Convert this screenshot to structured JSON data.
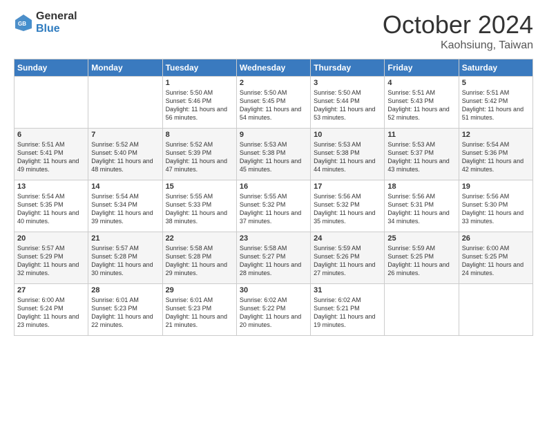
{
  "logo": {
    "general": "General",
    "blue": "Blue"
  },
  "header": {
    "month": "October 2024",
    "location": "Kaohsiung, Taiwan"
  },
  "weekdays": [
    "Sunday",
    "Monday",
    "Tuesday",
    "Wednesday",
    "Thursday",
    "Friday",
    "Saturday"
  ],
  "weeks": [
    [
      {
        "day": "",
        "sunrise": "",
        "sunset": "",
        "daylight": ""
      },
      {
        "day": "",
        "sunrise": "",
        "sunset": "",
        "daylight": ""
      },
      {
        "day": "1",
        "sunrise": "Sunrise: 5:50 AM",
        "sunset": "Sunset: 5:46 PM",
        "daylight": "Daylight: 11 hours and 56 minutes."
      },
      {
        "day": "2",
        "sunrise": "Sunrise: 5:50 AM",
        "sunset": "Sunset: 5:45 PM",
        "daylight": "Daylight: 11 hours and 54 minutes."
      },
      {
        "day": "3",
        "sunrise": "Sunrise: 5:50 AM",
        "sunset": "Sunset: 5:44 PM",
        "daylight": "Daylight: 11 hours and 53 minutes."
      },
      {
        "day": "4",
        "sunrise": "Sunrise: 5:51 AM",
        "sunset": "Sunset: 5:43 PM",
        "daylight": "Daylight: 11 hours and 52 minutes."
      },
      {
        "day": "5",
        "sunrise": "Sunrise: 5:51 AM",
        "sunset": "Sunset: 5:42 PM",
        "daylight": "Daylight: 11 hours and 51 minutes."
      }
    ],
    [
      {
        "day": "6",
        "sunrise": "Sunrise: 5:51 AM",
        "sunset": "Sunset: 5:41 PM",
        "daylight": "Daylight: 11 hours and 49 minutes."
      },
      {
        "day": "7",
        "sunrise": "Sunrise: 5:52 AM",
        "sunset": "Sunset: 5:40 PM",
        "daylight": "Daylight: 11 hours and 48 minutes."
      },
      {
        "day": "8",
        "sunrise": "Sunrise: 5:52 AM",
        "sunset": "Sunset: 5:39 PM",
        "daylight": "Daylight: 11 hours and 47 minutes."
      },
      {
        "day": "9",
        "sunrise": "Sunrise: 5:53 AM",
        "sunset": "Sunset: 5:38 PM",
        "daylight": "Daylight: 11 hours and 45 minutes."
      },
      {
        "day": "10",
        "sunrise": "Sunrise: 5:53 AM",
        "sunset": "Sunset: 5:38 PM",
        "daylight": "Daylight: 11 hours and 44 minutes."
      },
      {
        "day": "11",
        "sunrise": "Sunrise: 5:53 AM",
        "sunset": "Sunset: 5:37 PM",
        "daylight": "Daylight: 11 hours and 43 minutes."
      },
      {
        "day": "12",
        "sunrise": "Sunrise: 5:54 AM",
        "sunset": "Sunset: 5:36 PM",
        "daylight": "Daylight: 11 hours and 42 minutes."
      }
    ],
    [
      {
        "day": "13",
        "sunrise": "Sunrise: 5:54 AM",
        "sunset": "Sunset: 5:35 PM",
        "daylight": "Daylight: 11 hours and 40 minutes."
      },
      {
        "day": "14",
        "sunrise": "Sunrise: 5:54 AM",
        "sunset": "Sunset: 5:34 PM",
        "daylight": "Daylight: 11 hours and 39 minutes."
      },
      {
        "day": "15",
        "sunrise": "Sunrise: 5:55 AM",
        "sunset": "Sunset: 5:33 PM",
        "daylight": "Daylight: 11 hours and 38 minutes."
      },
      {
        "day": "16",
        "sunrise": "Sunrise: 5:55 AM",
        "sunset": "Sunset: 5:32 PM",
        "daylight": "Daylight: 11 hours and 37 minutes."
      },
      {
        "day": "17",
        "sunrise": "Sunrise: 5:56 AM",
        "sunset": "Sunset: 5:32 PM",
        "daylight": "Daylight: 11 hours and 35 minutes."
      },
      {
        "day": "18",
        "sunrise": "Sunrise: 5:56 AM",
        "sunset": "Sunset: 5:31 PM",
        "daylight": "Daylight: 11 hours and 34 minutes."
      },
      {
        "day": "19",
        "sunrise": "Sunrise: 5:56 AM",
        "sunset": "Sunset: 5:30 PM",
        "daylight": "Daylight: 11 hours and 33 minutes."
      }
    ],
    [
      {
        "day": "20",
        "sunrise": "Sunrise: 5:57 AM",
        "sunset": "Sunset: 5:29 PM",
        "daylight": "Daylight: 11 hours and 32 minutes."
      },
      {
        "day": "21",
        "sunrise": "Sunrise: 5:57 AM",
        "sunset": "Sunset: 5:28 PM",
        "daylight": "Daylight: 11 hours and 30 minutes."
      },
      {
        "day": "22",
        "sunrise": "Sunrise: 5:58 AM",
        "sunset": "Sunset: 5:28 PM",
        "daylight": "Daylight: 11 hours and 29 minutes."
      },
      {
        "day": "23",
        "sunrise": "Sunrise: 5:58 AM",
        "sunset": "Sunset: 5:27 PM",
        "daylight": "Daylight: 11 hours and 28 minutes."
      },
      {
        "day": "24",
        "sunrise": "Sunrise: 5:59 AM",
        "sunset": "Sunset: 5:26 PM",
        "daylight": "Daylight: 11 hours and 27 minutes."
      },
      {
        "day": "25",
        "sunrise": "Sunrise: 5:59 AM",
        "sunset": "Sunset: 5:25 PM",
        "daylight": "Daylight: 11 hours and 26 minutes."
      },
      {
        "day": "26",
        "sunrise": "Sunrise: 6:00 AM",
        "sunset": "Sunset: 5:25 PM",
        "daylight": "Daylight: 11 hours and 24 minutes."
      }
    ],
    [
      {
        "day": "27",
        "sunrise": "Sunrise: 6:00 AM",
        "sunset": "Sunset: 5:24 PM",
        "daylight": "Daylight: 11 hours and 23 minutes."
      },
      {
        "day": "28",
        "sunrise": "Sunrise: 6:01 AM",
        "sunset": "Sunset: 5:23 PM",
        "daylight": "Daylight: 11 hours and 22 minutes."
      },
      {
        "day": "29",
        "sunrise": "Sunrise: 6:01 AM",
        "sunset": "Sunset: 5:23 PM",
        "daylight": "Daylight: 11 hours and 21 minutes."
      },
      {
        "day": "30",
        "sunrise": "Sunrise: 6:02 AM",
        "sunset": "Sunset: 5:22 PM",
        "daylight": "Daylight: 11 hours and 20 minutes."
      },
      {
        "day": "31",
        "sunrise": "Sunrise: 6:02 AM",
        "sunset": "Sunset: 5:21 PM",
        "daylight": "Daylight: 11 hours and 19 minutes."
      },
      {
        "day": "",
        "sunrise": "",
        "sunset": "",
        "daylight": ""
      },
      {
        "day": "",
        "sunrise": "",
        "sunset": "",
        "daylight": ""
      }
    ]
  ]
}
